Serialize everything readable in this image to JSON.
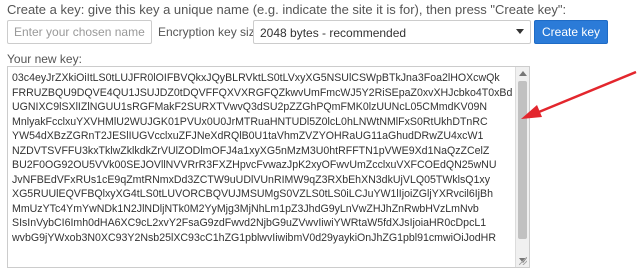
{
  "instructions": "Create a key: give this key a unique name (e.g. indicate the site it is for), then press \"Create key\":",
  "form": {
    "name_placeholder": "Enter your chosen name",
    "size_label": "Encryption key size:",
    "size_value": "2048 bytes - recommended",
    "create_label": "Create key"
  },
  "key": {
    "label": "Your new key:",
    "lines": [
      "03c4eyJrZXkiOiItLS0tLUJFR0lOIFBVQkxJQyBLRVktLS0tLVxyXG5NSUlCSWpBTkJna3Foa2lHOXcwQk",
      "FRRUZBQU9DQVE4QU1JSUJDZ0tDQVFFQXVXRGFQZkwvUmFmcWJ5Y2RiSEpaZ0xvXHJcbko4T0xBdENNx",
      "UGNIXC9lSXlIZlNGUU1sRGFMakF2SURXTVwvQ3dSU2pZZGhPQmFMK0lzUUNcL05CMmdKV09N",
      "MnlyakFcclxuYXVHMlU2WUJGK01PVUx0U0JrMTRuaHNTUDl5Z0lcL0hLNWtNMlFxS0RtUkhDTnRC",
      "YW54dXBzZGRnT2JESlIUGVcclxuZFJNeXdRQlB0U1taVhmZVZYOHRaUG11aGhudDRwZU4xcW1",
      "NZDVTSVFFU3kxTklwZklkdkZrVUlZODlmOFJ4a1xyXG5nMzM3U0htRFFTN1pVWE9Xd1NaQzZCelZ",
      "BU2F0OG92OU5VVk00SEJOVllNVVRrR3FXZHpvcFvwazJpK2xyOFwvUmZcclxuVXFCOEdQN25wNU",
      "JvNFBEdVFxRUs1cE9qZmtRNmxDd3ZCTW9uUDlVUnRIMW9qZ3RXbEhXN3dkUjVLQ05TWklsQ1xy",
      "XG5RUUlEQVFBQlxyXG4tLS0tLUVORCBQVUJMSUMgS0VZLS0tLS0iLCJuYW1lIjoiZGljYXRvcil6IjBh",
      "MmUzYTc4YmYwNDk1N2JlNDljNTk0M2YyMjg3MjNhLm1pZ3JhdG9yLnVwZHJhZnRwbHVzLmNvb",
      "SIsInVybCI6Imh0dHA6XC9cL2xvY2FsaG9zdFwvd2NjbG9uZVwvIiwiYWRtaW5fdXJsIjoiaHR0cDpcL1",
      "wvbG9jYWxob3N0XC93Y2Nsb25lXC93cC1hZG1pblwvIiwibmV0d29yaykiOnJhZG1pbl91cmwiOiJodHR"
    ]
  },
  "colors": {
    "accent": "#2b7bd8",
    "arrow": "#e3262d"
  },
  "icons": {
    "select_chevron": "chevron-down-icon",
    "arrow": "red-arrow-annotation"
  }
}
